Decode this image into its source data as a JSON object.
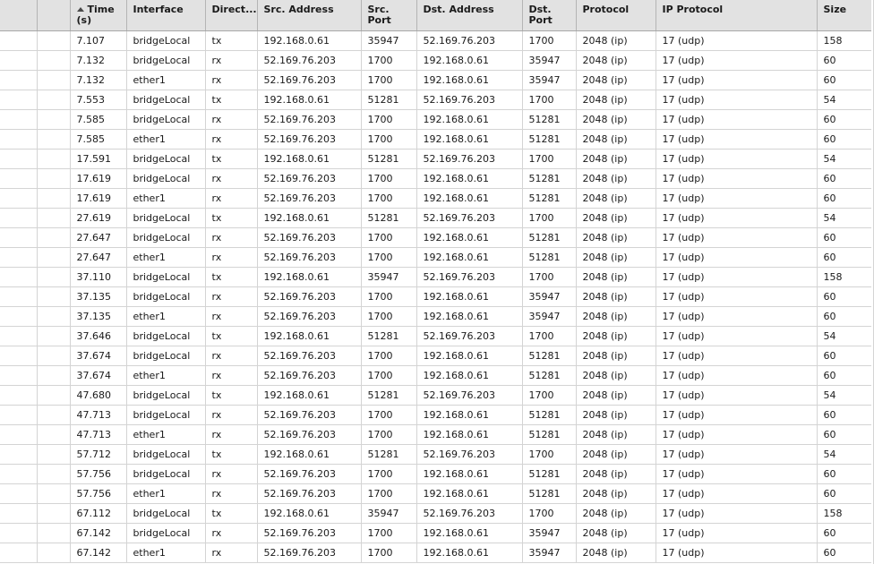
{
  "table": {
    "sort": {
      "column": "Time (s)",
      "direction": "ascending",
      "icon": "sort-ascending-arrow-icon"
    },
    "columns": [
      {
        "key": "sel1",
        "label": ""
      },
      {
        "key": "sel2",
        "label": ""
      },
      {
        "key": "time",
        "label": "Time (s)"
      },
      {
        "key": "iface",
        "label": "Interface"
      },
      {
        "key": "dir",
        "label": "Direct..."
      },
      {
        "key": "src",
        "label": "Src. Address"
      },
      {
        "key": "sport",
        "label": "Src. Port"
      },
      {
        "key": "dst",
        "label": "Dst. Address"
      },
      {
        "key": "dport",
        "label": "Dst. Port"
      },
      {
        "key": "proto",
        "label": "Protocol"
      },
      {
        "key": "ipproto",
        "label": "IP Protocol"
      },
      {
        "key": "size",
        "label": "Size"
      }
    ],
    "rows": [
      [
        "",
        "",
        "7.107",
        "bridgeLocal",
        "tx",
        "192.168.0.61",
        "35947",
        "52.169.76.203",
        "1700",
        "2048 (ip)",
        "17 (udp)",
        "158"
      ],
      [
        "",
        "",
        "7.132",
        "bridgeLocal",
        "rx",
        "52.169.76.203",
        "1700",
        "192.168.0.61",
        "35947",
        "2048 (ip)",
        "17 (udp)",
        "60"
      ],
      [
        "",
        "",
        "7.132",
        "ether1",
        "rx",
        "52.169.76.203",
        "1700",
        "192.168.0.61",
        "35947",
        "2048 (ip)",
        "17 (udp)",
        "60"
      ],
      [
        "",
        "",
        "7.553",
        "bridgeLocal",
        "tx",
        "192.168.0.61",
        "51281",
        "52.169.76.203",
        "1700",
        "2048 (ip)",
        "17 (udp)",
        "54"
      ],
      [
        "",
        "",
        "7.585",
        "bridgeLocal",
        "rx",
        "52.169.76.203",
        "1700",
        "192.168.0.61",
        "51281",
        "2048 (ip)",
        "17 (udp)",
        "60"
      ],
      [
        "",
        "",
        "7.585",
        "ether1",
        "rx",
        "52.169.76.203",
        "1700",
        "192.168.0.61",
        "51281",
        "2048 (ip)",
        "17 (udp)",
        "60"
      ],
      [
        "",
        "",
        "17.591",
        "bridgeLocal",
        "tx",
        "192.168.0.61",
        "51281",
        "52.169.76.203",
        "1700",
        "2048 (ip)",
        "17 (udp)",
        "54"
      ],
      [
        "",
        "",
        "17.619",
        "bridgeLocal",
        "rx",
        "52.169.76.203",
        "1700",
        "192.168.0.61",
        "51281",
        "2048 (ip)",
        "17 (udp)",
        "60"
      ],
      [
        "",
        "",
        "17.619",
        "ether1",
        "rx",
        "52.169.76.203",
        "1700",
        "192.168.0.61",
        "51281",
        "2048 (ip)",
        "17 (udp)",
        "60"
      ],
      [
        "",
        "",
        "27.619",
        "bridgeLocal",
        "tx",
        "192.168.0.61",
        "51281",
        "52.169.76.203",
        "1700",
        "2048 (ip)",
        "17 (udp)",
        "54"
      ],
      [
        "",
        "",
        "27.647",
        "bridgeLocal",
        "rx",
        "52.169.76.203",
        "1700",
        "192.168.0.61",
        "51281",
        "2048 (ip)",
        "17 (udp)",
        "60"
      ],
      [
        "",
        "",
        "27.647",
        "ether1",
        "rx",
        "52.169.76.203",
        "1700",
        "192.168.0.61",
        "51281",
        "2048 (ip)",
        "17 (udp)",
        "60"
      ],
      [
        "",
        "",
        "37.110",
        "bridgeLocal",
        "tx",
        "192.168.0.61",
        "35947",
        "52.169.76.203",
        "1700",
        "2048 (ip)",
        "17 (udp)",
        "158"
      ],
      [
        "",
        "",
        "37.135",
        "bridgeLocal",
        "rx",
        "52.169.76.203",
        "1700",
        "192.168.0.61",
        "35947",
        "2048 (ip)",
        "17 (udp)",
        "60"
      ],
      [
        "",
        "",
        "37.135",
        "ether1",
        "rx",
        "52.169.76.203",
        "1700",
        "192.168.0.61",
        "35947",
        "2048 (ip)",
        "17 (udp)",
        "60"
      ],
      [
        "",
        "",
        "37.646",
        "bridgeLocal",
        "tx",
        "192.168.0.61",
        "51281",
        "52.169.76.203",
        "1700",
        "2048 (ip)",
        "17 (udp)",
        "54"
      ],
      [
        "",
        "",
        "37.674",
        "bridgeLocal",
        "rx",
        "52.169.76.203",
        "1700",
        "192.168.0.61",
        "51281",
        "2048 (ip)",
        "17 (udp)",
        "60"
      ],
      [
        "",
        "",
        "37.674",
        "ether1",
        "rx",
        "52.169.76.203",
        "1700",
        "192.168.0.61",
        "51281",
        "2048 (ip)",
        "17 (udp)",
        "60"
      ],
      [
        "",
        "",
        "47.680",
        "bridgeLocal",
        "tx",
        "192.168.0.61",
        "51281",
        "52.169.76.203",
        "1700",
        "2048 (ip)",
        "17 (udp)",
        "54"
      ],
      [
        "",
        "",
        "47.713",
        "bridgeLocal",
        "rx",
        "52.169.76.203",
        "1700",
        "192.168.0.61",
        "51281",
        "2048 (ip)",
        "17 (udp)",
        "60"
      ],
      [
        "",
        "",
        "47.713",
        "ether1",
        "rx",
        "52.169.76.203",
        "1700",
        "192.168.0.61",
        "51281",
        "2048 (ip)",
        "17 (udp)",
        "60"
      ],
      [
        "",
        "",
        "57.712",
        "bridgeLocal",
        "tx",
        "192.168.0.61",
        "51281",
        "52.169.76.203",
        "1700",
        "2048 (ip)",
        "17 (udp)",
        "54"
      ],
      [
        "",
        "",
        "57.756",
        "bridgeLocal",
        "rx",
        "52.169.76.203",
        "1700",
        "192.168.0.61",
        "51281",
        "2048 (ip)",
        "17 (udp)",
        "60"
      ],
      [
        "",
        "",
        "57.756",
        "ether1",
        "rx",
        "52.169.76.203",
        "1700",
        "192.168.0.61",
        "51281",
        "2048 (ip)",
        "17 (udp)",
        "60"
      ],
      [
        "",
        "",
        "67.112",
        "bridgeLocal",
        "tx",
        "192.168.0.61",
        "35947",
        "52.169.76.203",
        "1700",
        "2048 (ip)",
        "17 (udp)",
        "158"
      ],
      [
        "",
        "",
        "67.142",
        "bridgeLocal",
        "rx",
        "52.169.76.203",
        "1700",
        "192.168.0.61",
        "35947",
        "2048 (ip)",
        "17 (udp)",
        "60"
      ],
      [
        "",
        "",
        "67.142",
        "ether1",
        "rx",
        "52.169.76.203",
        "1700",
        "192.168.0.61",
        "35947",
        "2048 (ip)",
        "17 (udp)",
        "60"
      ]
    ]
  },
  "colors": {
    "header_bg": "#e2e2e2",
    "header_border": "#b4b4b4",
    "row_border": "#d4d4d4",
    "text": "#1a1a1a",
    "row_bg": "#ffffff"
  }
}
